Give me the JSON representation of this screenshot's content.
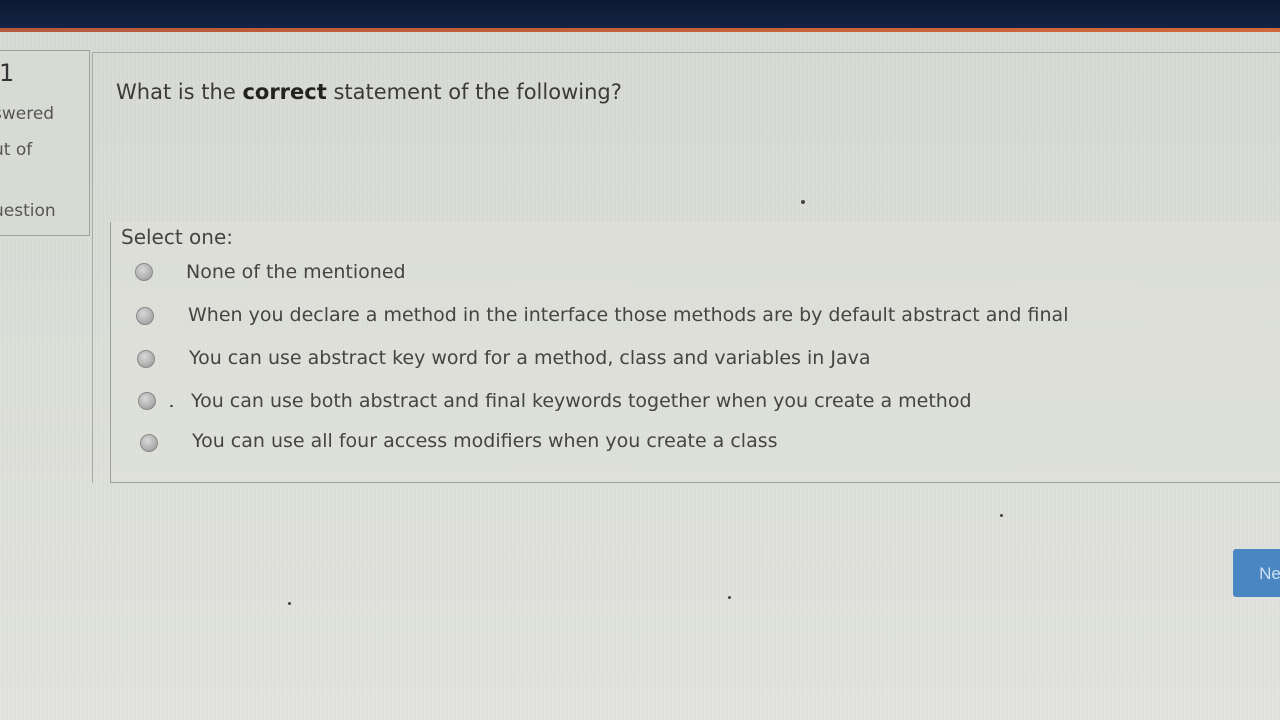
{
  "info": {
    "number": "1",
    "answered": "swered",
    "out_of": "ut of",
    "question": "uestion"
  },
  "question": {
    "prefix": "What is the ",
    "bold": "correct",
    "suffix": " statement of the following?"
  },
  "answer": {
    "prompt": "Select one:",
    "options": [
      {
        "label": "None of the mentioned",
        "selected": false
      },
      {
        "label": "When you declare a method in the interface those methods are by default abstract and final",
        "selected": false
      },
      {
        "label": "You can use abstract key word for a method, class and variables in Java",
        "selected": false
      },
      {
        "label": "You can use both abstract and final keywords together when you create a method",
        "selected": false
      },
      {
        "label": "You can use all four access modifiers when you create a class",
        "selected": false
      }
    ]
  },
  "navigation": {
    "next_label": "Ne"
  },
  "colors": {
    "topbar": "#0e1a33",
    "accent": "#c4603a",
    "next_button": "#4a86c2"
  }
}
